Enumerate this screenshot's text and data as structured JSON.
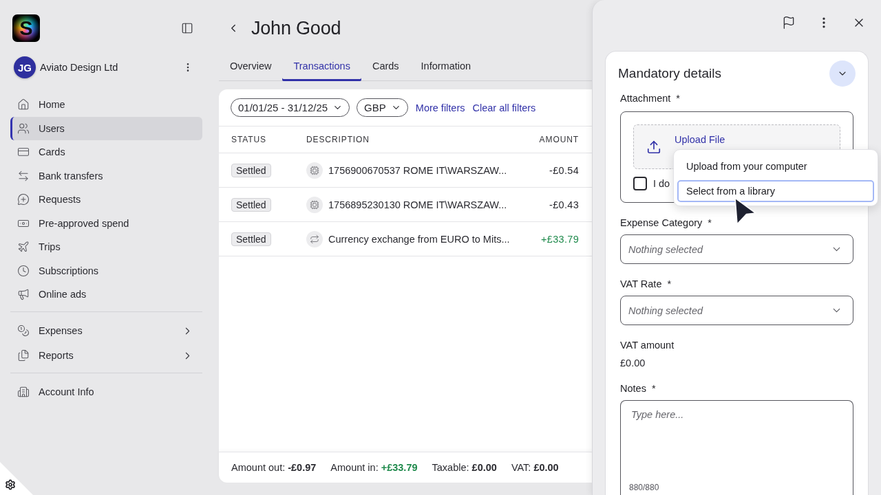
{
  "logo": {
    "letter": "S"
  },
  "account": {
    "initials": "JG",
    "name": "Aviato Design Ltd"
  },
  "sidebar": {
    "sections": [
      {
        "items": [
          {
            "label": "Home",
            "selected": false,
            "submenu": false
          },
          {
            "label": "Users",
            "selected": true,
            "submenu": false
          },
          {
            "label": "Cards",
            "selected": false,
            "submenu": false
          },
          {
            "label": "Bank transfers",
            "selected": false,
            "submenu": false
          },
          {
            "label": "Requests",
            "selected": false,
            "submenu": false
          },
          {
            "label": "Pre-approved spend",
            "selected": false,
            "submenu": false
          },
          {
            "label": "Trips",
            "selected": false,
            "submenu": false
          },
          {
            "label": "Subscriptions",
            "selected": false,
            "submenu": false
          },
          {
            "label": "Online ads",
            "selected": false,
            "submenu": false
          }
        ]
      },
      {
        "items": [
          {
            "label": "Expenses",
            "selected": false,
            "submenu": true
          },
          {
            "label": "Reports",
            "selected": false,
            "submenu": true
          }
        ]
      },
      {
        "items": [
          {
            "label": "Account Info",
            "selected": false,
            "submenu": false
          }
        ]
      }
    ]
  },
  "page": {
    "title": "John Good"
  },
  "tabs": [
    {
      "label": "Overview",
      "selected": false
    },
    {
      "label": "Transactions",
      "selected": true
    },
    {
      "label": "Cards",
      "selected": false
    },
    {
      "label": "Information",
      "selected": false
    }
  ],
  "filters": {
    "date_range": "01/01/25 - 31/12/25",
    "currency": "GBP",
    "links": [
      "More filters",
      "Clear all filters"
    ]
  },
  "table": {
    "columns": [
      "STATUS",
      "DESCRIPTION",
      "AMOUNT"
    ],
    "rows": [
      {
        "status": "Settled",
        "kind": "payment",
        "description": "1756900670537 ROME IT\\WARSZAW...",
        "amount": "-£0.54",
        "positive": false
      },
      {
        "status": "Settled",
        "kind": "payment",
        "description": "1756895230130 ROME IT\\WARSZAW...",
        "amount": "-£0.43",
        "positive": false
      },
      {
        "status": "Settled",
        "kind": "exchange",
        "description": "Currency exchange from EURO to Mits...",
        "amount": "+£33.79",
        "positive": true
      }
    ]
  },
  "summary": [
    {
      "label": "Amount out:",
      "value": "-£0.97",
      "positive": false
    },
    {
      "label": "Amount in:",
      "value": "+£33.79",
      "positive": true
    },
    {
      "label": "Taxable:",
      "value": "£0.00",
      "positive": false
    },
    {
      "label": "VAT:",
      "value": "£0.00",
      "positive": false
    }
  ],
  "details": {
    "title": "Mandatory details",
    "fields": [
      {
        "kind": "attachment",
        "label": "Attachment",
        "marker": "*",
        "upload_label": "Upload File",
        "checkbox": {
          "label": "I do",
          "checked": false
        },
        "menu": [
          {
            "label": "Upload from your computer",
            "selected": false
          },
          {
            "label": "Select from a library",
            "selected": true
          }
        ]
      },
      {
        "kind": "select",
        "label": "Expense Category",
        "marker": "*",
        "placeholder": "Nothing selected"
      },
      {
        "kind": "select",
        "label": "VAT Rate",
        "marker": "*",
        "placeholder": "Nothing selected"
      },
      {
        "kind": "value",
        "label": "VAT amount",
        "value": "£0.00"
      },
      {
        "kind": "textarea",
        "label": "Notes",
        "marker": "*",
        "placeholder": "Type here...",
        "counter": "880/880"
      }
    ]
  }
}
